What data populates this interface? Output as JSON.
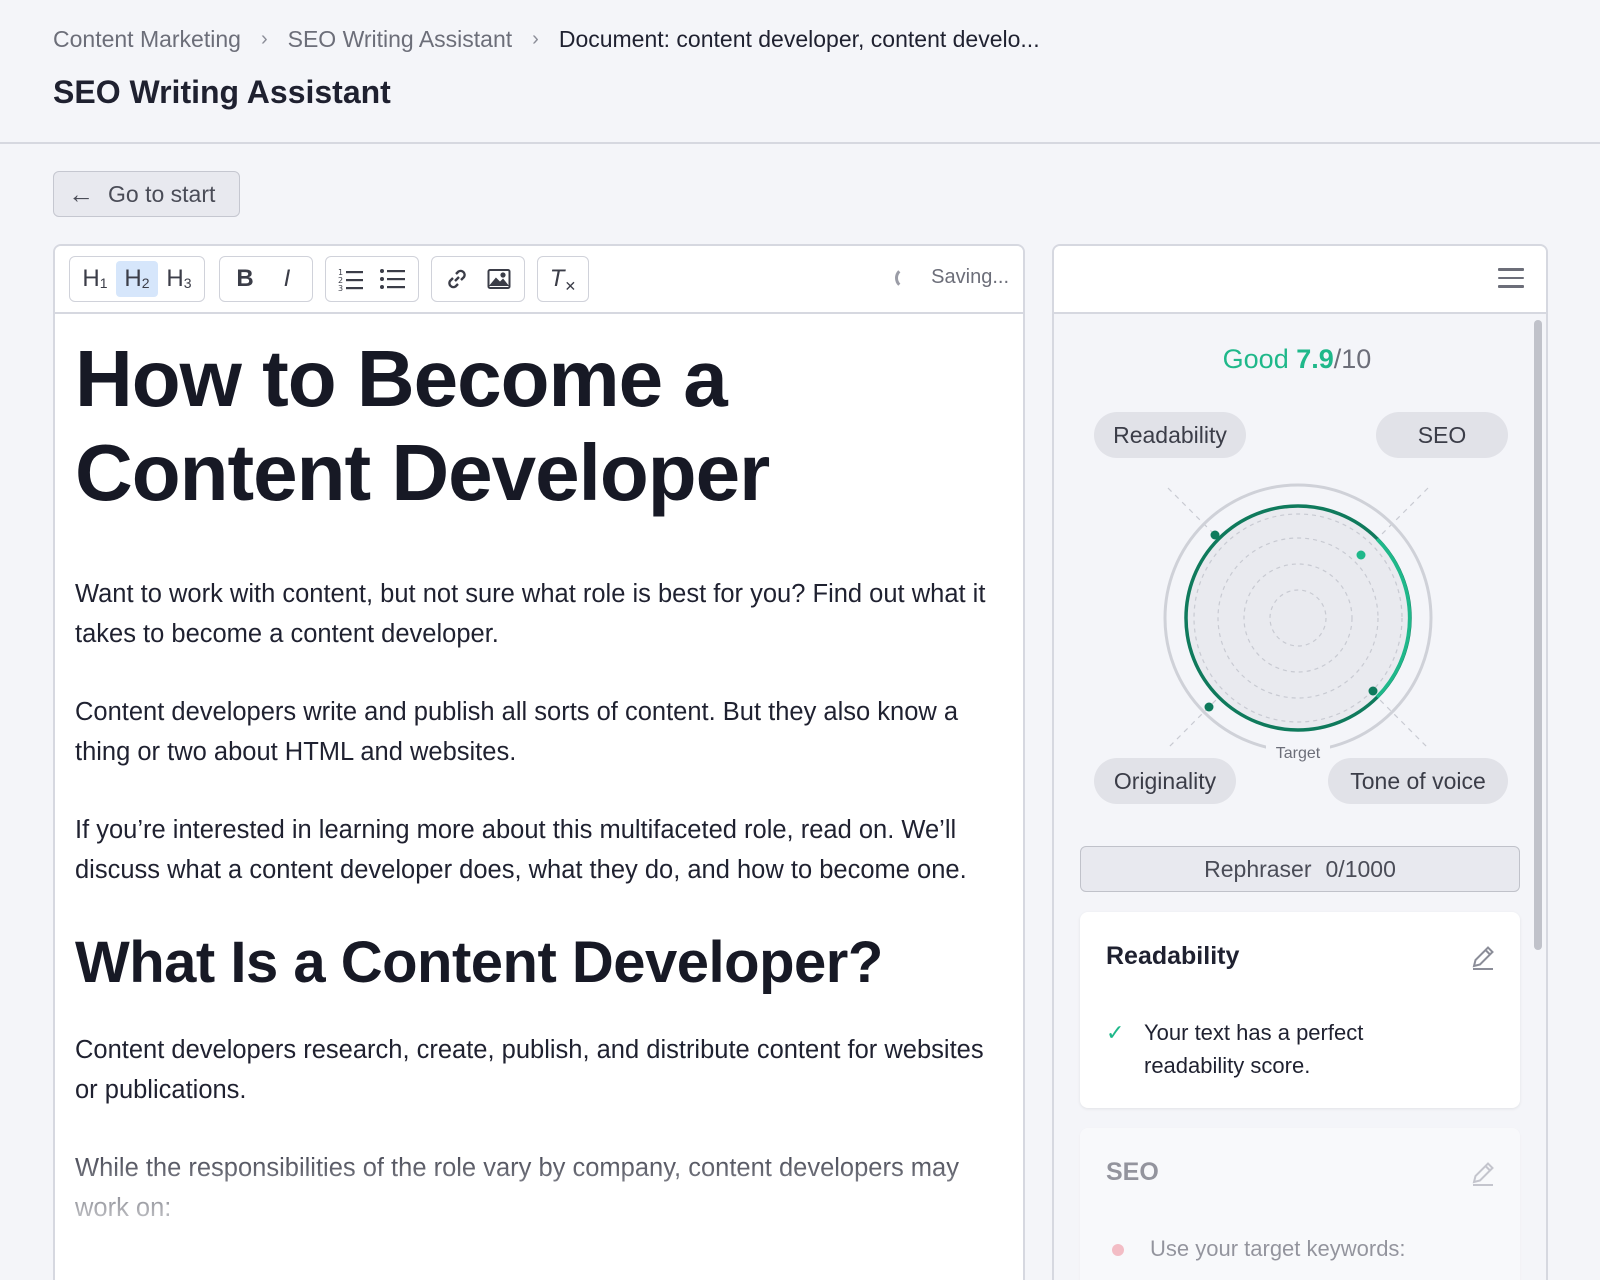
{
  "breadcrumb": {
    "items": [
      "Content Marketing",
      "SEO Writing Assistant"
    ],
    "current": "Document: content developer, content develo...",
    "separator": ">"
  },
  "page_title": "SEO Writing Assistant",
  "back_button": {
    "label": "Go to start",
    "icon": "arrow-left-icon"
  },
  "toolbar": {
    "headings": [
      "H",
      "H",
      "H"
    ],
    "heading_levels": [
      "1",
      "2",
      "3"
    ],
    "active_heading": "H2",
    "bold": "B",
    "italic": "I",
    "clear_format": "T",
    "status": "Saving..."
  },
  "document": {
    "title": "How to Become a Content Developer",
    "paragraphs": [
      "Want to work with content, but not sure what role is best for you? Find out what it takes to become a content developer.",
      "Content developers write and publish all sorts of content. But they also know a thing or two about HTML and websites.",
      "If you’re interested in learning more about this multifaceted role, read on. We’ll discuss what a content developer does, what they do, and how to become one."
    ],
    "section_heading": "What Is a Content Developer?",
    "section_paragraphs": [
      "Content developers research, create, publish, and distribute content for websites or publications.",
      "While the responsibilities of the role vary by company, content developers may work on:"
    ]
  },
  "panel": {
    "score": {
      "label": "Good",
      "value": "7.9",
      "out_of": "/10"
    },
    "score_value": 7.9,
    "score_max": 10,
    "metrics": {
      "readability": "Readability",
      "seo": "SEO",
      "originality": "Originality",
      "tone": "Tone of voice"
    },
    "target_label": "Target",
    "rephraser": {
      "label": "Rephraser",
      "count": "0/1000"
    },
    "cards": [
      {
        "title": "Readability",
        "item": "Your text has a perfect readability score.",
        "status": "ok"
      },
      {
        "title": "SEO",
        "item": "Use your target keywords:",
        "status": "warning"
      }
    ]
  },
  "colors": {
    "accent_green": "#1fb88a",
    "dark_green": "#0f7a5c",
    "warning_dot": "#f27b87",
    "active_toolbar": "#d6e6fb"
  }
}
